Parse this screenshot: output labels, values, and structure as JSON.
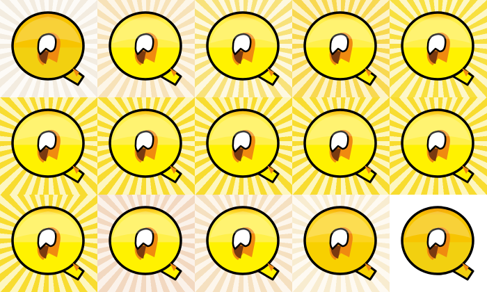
{
  "tiles": [
    {
      "icon": "letter-q-icon",
      "ray": "#f3ece0",
      "base": "#fdfbf7",
      "top": "#f7c400",
      "bottom": "#f2d010",
      "rim": "#f39c12"
    },
    {
      "icon": "letter-q-icon",
      "ray": "#f7e2b8",
      "base": "#fdf6e8",
      "top": "#fff04a",
      "bottom": "#fff200",
      "rim": "#f7b000"
    },
    {
      "icon": "letter-q-icon",
      "ray": "#f8e27a",
      "base": "#fdf8e0",
      "top": "#fff04a",
      "bottom": "#fff200",
      "rim": "#f7b000"
    },
    {
      "icon": "letter-q-icon",
      "ray": "#f8d850",
      "base": "#fdf3c8",
      "top": "#fff04a",
      "bottom": "#fff200",
      "rim": "#f7b000"
    },
    {
      "icon": "letter-q-icon",
      "ray": "#f8e040",
      "base": "#fdf7c8",
      "top": "#fff04a",
      "bottom": "#fff200",
      "rim": "#f7b000"
    },
    {
      "icon": "letter-q-icon",
      "ray": "#f8dc30",
      "base": "#fdf6c0",
      "top": "#fff04a",
      "bottom": "#fff200",
      "rim": "#f7b000"
    },
    {
      "icon": "letter-q-icon",
      "ray": "#f8dc30",
      "base": "#fdf6c0",
      "top": "#fff04a",
      "bottom": "#fff200",
      "rim": "#f7b000"
    },
    {
      "icon": "letter-q-icon",
      "ray": "#f8dc30",
      "base": "#fdf6c0",
      "top": "#fff04a",
      "bottom": "#fff200",
      "rim": "#f7b000"
    },
    {
      "icon": "letter-q-icon",
      "ray": "#f8dc30",
      "base": "#fdf6c0",
      "top": "#fff04a",
      "bottom": "#fff200",
      "rim": "#f7b000"
    },
    {
      "icon": "letter-q-icon",
      "ray": "#f8dc30",
      "base": "#fdf6c0",
      "top": "#fff04a",
      "bottom": "#fff200",
      "rim": "#f7b000"
    },
    {
      "icon": "letter-q-icon",
      "ray": "#f8dc30",
      "base": "#fdf6c0",
      "top": "#fff04a",
      "bottom": "#fff200",
      "rim": "#f7b000"
    },
    {
      "icon": "letter-q-icon",
      "ray": "#f2d8c0",
      "base": "#fbf2ea",
      "top": "#fff04a",
      "bottom": "#fff200",
      "rim": "#f7b000"
    },
    {
      "icon": "letter-q-icon",
      "ray": "#f5e0c0",
      "base": "#fdf6ec",
      "top": "#fff04a",
      "bottom": "#fff200",
      "rim": "#f7b000"
    },
    {
      "icon": "letter-q-icon",
      "ray": "#f8ecd0",
      "base": "#fefaf2",
      "top": "#fcd420",
      "bottom": "#f8d000",
      "rim": "#f5a000"
    },
    {
      "icon": "letter-q-icon",
      "ray": "#ffffff",
      "base": "#ffffff",
      "top": "#f7c400",
      "bottom": "#f2d010",
      "rim": "#f39c12"
    }
  ]
}
